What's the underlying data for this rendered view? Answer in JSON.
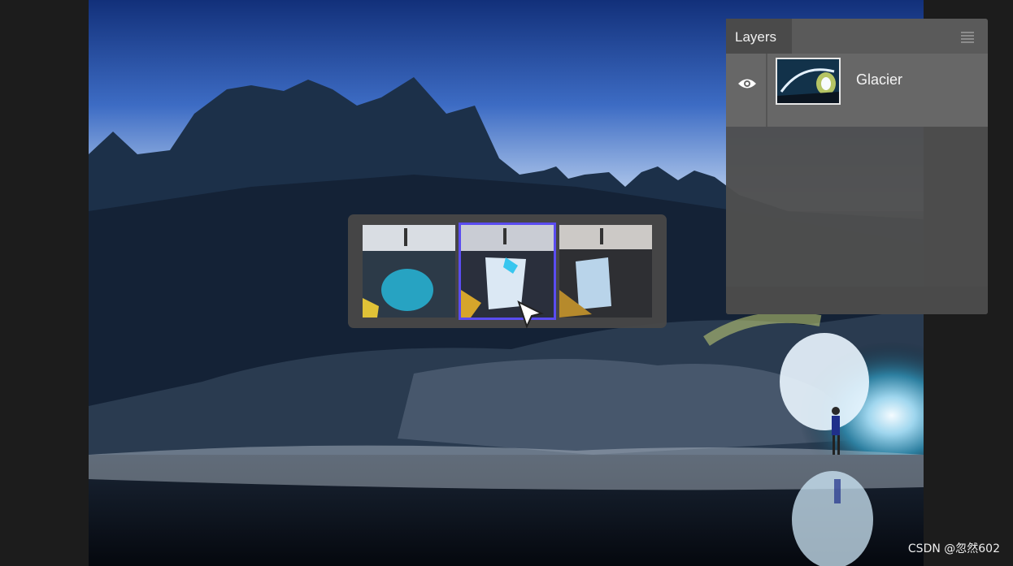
{
  "layers_panel": {
    "tab_label": "Layers",
    "menu_icon": "hamburger-menu-icon",
    "layers": [
      {
        "name": "Glacier",
        "visible": true,
        "visibility_icon": "eye-icon"
      }
    ]
  },
  "variations": {
    "items": [
      {
        "id": "variation-1",
        "selected": false
      },
      {
        "id": "variation-2",
        "selected": true
      },
      {
        "id": "variation-3",
        "selected": false
      }
    ],
    "selection_color": "#5a4cf0"
  },
  "cursor_icon": "pointer-arrow-icon",
  "watermark": "CSDN @忽然602"
}
